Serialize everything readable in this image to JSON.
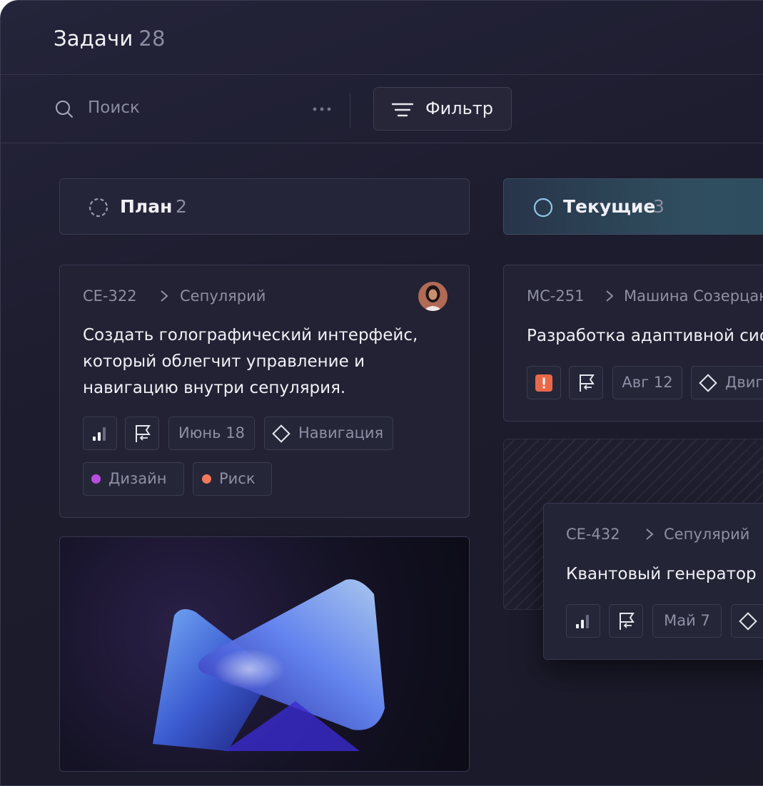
{
  "header": {
    "title": "Задачи",
    "count": "28"
  },
  "toolbar": {
    "search_placeholder": "Поиск",
    "filter_label": "Фильтр"
  },
  "columns": [
    {
      "name": "План",
      "count": "2"
    },
    {
      "name": "Текущие",
      "count": "3"
    }
  ],
  "cards": {
    "ce322": {
      "id": "CE-322",
      "project": "Сепулярий",
      "lines": [
        "Создать голографический интерфейс,",
        "который облегчит управление и",
        "навигацию внутри сепулярия."
      ],
      "date": "Июнь 18",
      "area": "Навигация",
      "labels": [
        {
          "text": "Дизайн",
          "color": "#b84ee0"
        },
        {
          "text": "Риск",
          "color": "#f07a5a"
        }
      ]
    },
    "mc251": {
      "id": "MC-251",
      "project": "Машина Созерцания",
      "line": "Разработка адаптивной системы",
      "date": "Авг 12",
      "area": "Двигатель"
    },
    "ce432": {
      "id": "CE-432",
      "project": "Сепулярий",
      "line": "Квантовый генератор",
      "date": "Май 7"
    }
  },
  "colors": {
    "accent_urgent": "#e8694a",
    "label_design": "#b84ee0",
    "label_risk": "#f07a5a"
  }
}
